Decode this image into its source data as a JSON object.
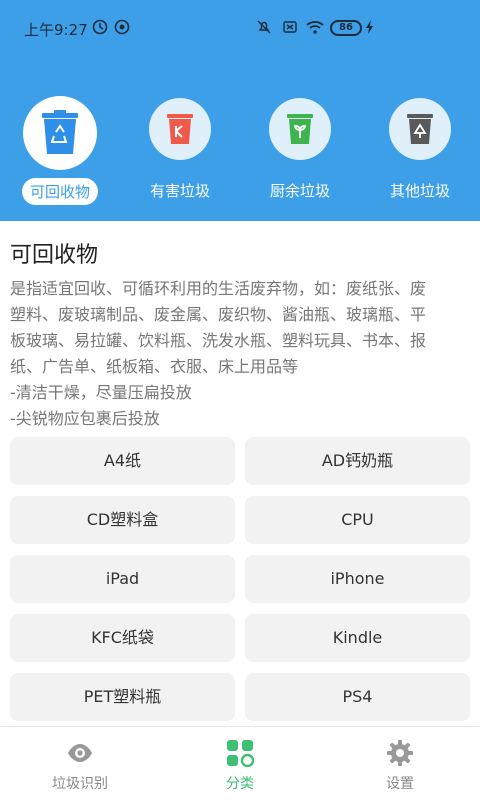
{
  "status_bar": {
    "time": "上午9:27",
    "battery": "86",
    "icons": [
      "alarm-icon",
      "nfc-icon",
      "mute-icon",
      "sim-icon",
      "wifi-icon",
      "battery-icon",
      "charging-icon"
    ]
  },
  "categories": [
    {
      "label": "可回收物",
      "icon": "recycle-bin-icon",
      "color": "#2e8fe8",
      "active": true
    },
    {
      "label": "有害垃圾",
      "icon": "hazardous-bin-icon",
      "color": "#f05a4a",
      "active": false
    },
    {
      "label": "厨余垃圾",
      "icon": "kitchen-bin-icon",
      "color": "#3fb34f",
      "active": false
    },
    {
      "label": "其他垃圾",
      "icon": "other-bin-icon",
      "color": "#5a5a5a",
      "active": false
    }
  ],
  "detail": {
    "title": "可回收物",
    "lines": [
      "是指适宜回收、可循环利用的生活废弃物，如：废纸张、废",
      "塑料、废玻璃制品、废金属、废织物、酱油瓶、玻璃瓶、平",
      "板玻璃、易拉罐、饮料瓶、洗发水瓶、塑料玩具、书本、报",
      "纸、广告单、纸板箱、衣服、床上用品等",
      "-清洁干燥，尽量压扁投放",
      "-尖锐物应包裹后投放"
    ]
  },
  "items": [
    "A4纸",
    "AD钙奶瓶",
    "CD塑料盒",
    "CPU",
    "iPad",
    "iPhone",
    "KFC纸袋",
    "Kindle",
    "PET塑料瓶",
    "PS4"
  ],
  "bottom_nav": [
    {
      "label": "垃圾识别",
      "icon": "eye-icon",
      "active": false
    },
    {
      "label": "分类",
      "icon": "category-grid-icon",
      "active": true
    },
    {
      "label": "设置",
      "icon": "gear-icon",
      "active": false
    }
  ],
  "colors": {
    "header": "#3d9fe8",
    "accent_green": "#3ec074"
  }
}
